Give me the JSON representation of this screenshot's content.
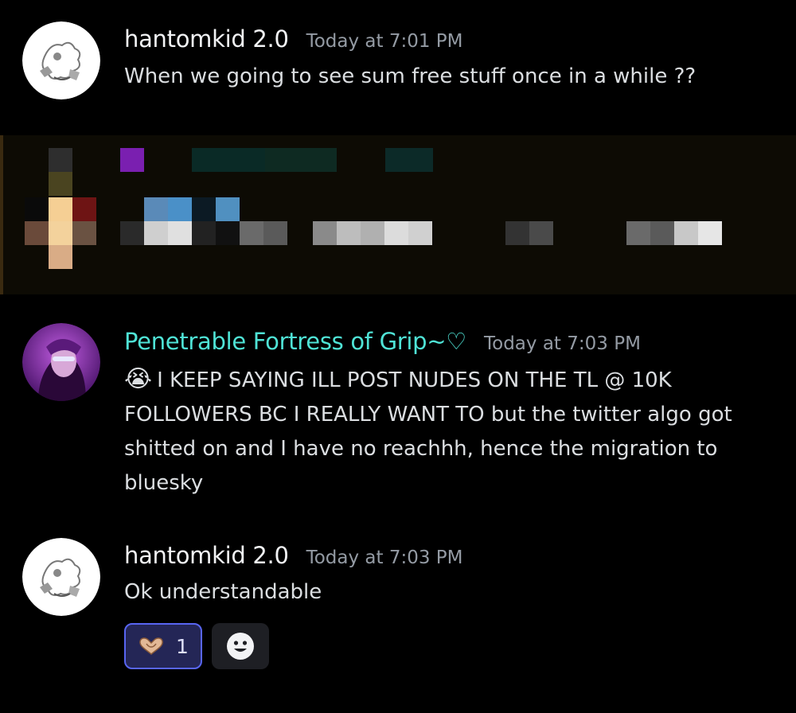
{
  "messages": [
    {
      "author": "hantomkid 2.0",
      "timestamp": "Today at 7:01 PM",
      "text": "When we going to see sum free stuff once in a while ??",
      "author_color": "#f2f3f5"
    },
    {
      "author": "Penetrable Fortress of Grip~♡",
      "timestamp": "Today at 7:03 PM",
      "emoji": "😭",
      "text": "I KEEP SAYING ILL POST NUDES ON THE TL @ 10K FOLLOWERS BC I REALLY WANT TO but the twitter algo got shitted on and I have no reachhh, hence the migration to bluesky",
      "author_color": "#4fe3d6"
    },
    {
      "author": "hantomkid 2.0",
      "timestamp": "Today at 7:03 PM",
      "text": "Ok understandable",
      "author_color": "#f2f3f5"
    }
  ],
  "reactions": [
    {
      "emoji": "heart-hands-icon",
      "count": "1",
      "active": true
    },
    {
      "emoji": "add-reaction-icon",
      "active": false
    }
  ],
  "colors": {
    "background": "#000000",
    "accent": "#5865f2",
    "timestamp": "#949ba4",
    "message_text": "#dbdee1"
  }
}
